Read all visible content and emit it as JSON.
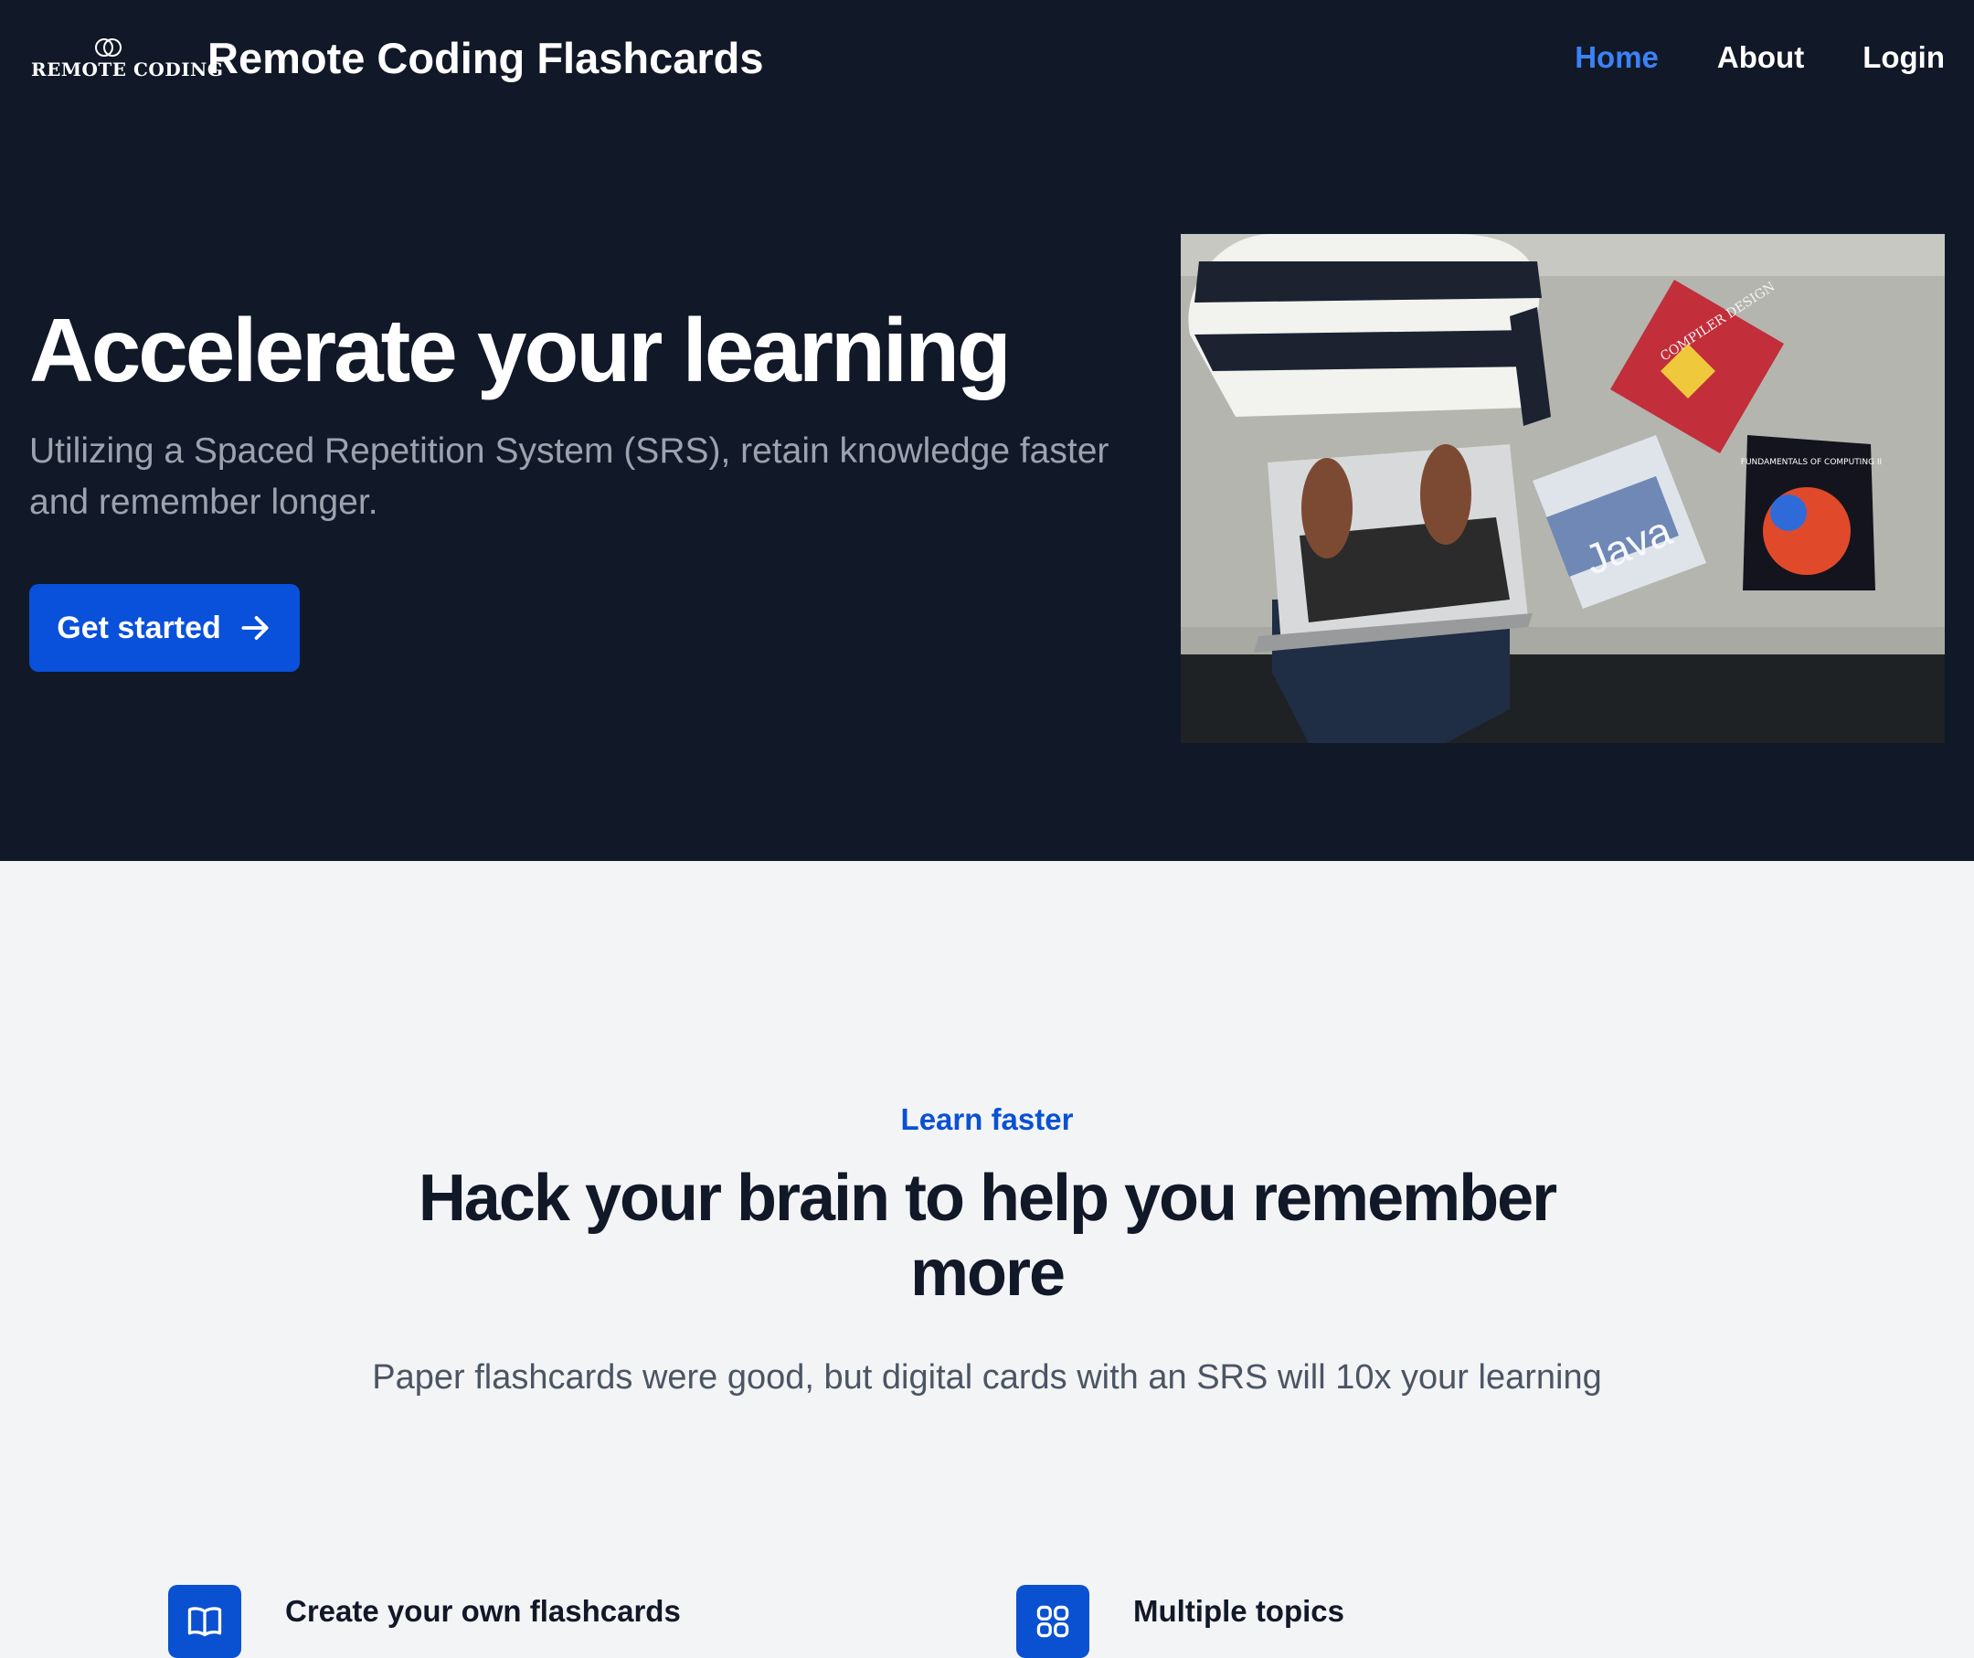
{
  "header": {
    "logo_text": "REMOTE CODING",
    "brand_title": "Remote Coding Flashcards",
    "nav": [
      {
        "label": "Home",
        "active": true
      },
      {
        "label": "About",
        "active": false
      },
      {
        "label": "Login",
        "active": false
      }
    ]
  },
  "hero": {
    "title": "Accelerate your learning",
    "subtitle": "Utilizing a Spaced Repetition System (SRS), retain knowledge faster and remember longer.",
    "cta_label": "Get started",
    "cta_icon": "arrow-right-icon",
    "image": {
      "book_1": "COMPILER DESIGN",
      "book_2": "Java",
      "book_3": "FUNDAMENTALS OF COMPUTING II"
    }
  },
  "features_section": {
    "eyebrow": "Learn faster",
    "title": "Hack your brain to help you remember more",
    "description": "Paper flashcards were good, but digital cards with an SRS will 10x your learning",
    "features": [
      {
        "title": "Create your own flashcards",
        "icon": "book-open-icon"
      },
      {
        "title": "Multiple topics",
        "icon": "grid-icon"
      }
    ]
  },
  "colors": {
    "hero_bg": "#111827",
    "accent": "#0950db",
    "nav_active": "#3b82f6",
    "section_bg": "#f3f4f6"
  }
}
